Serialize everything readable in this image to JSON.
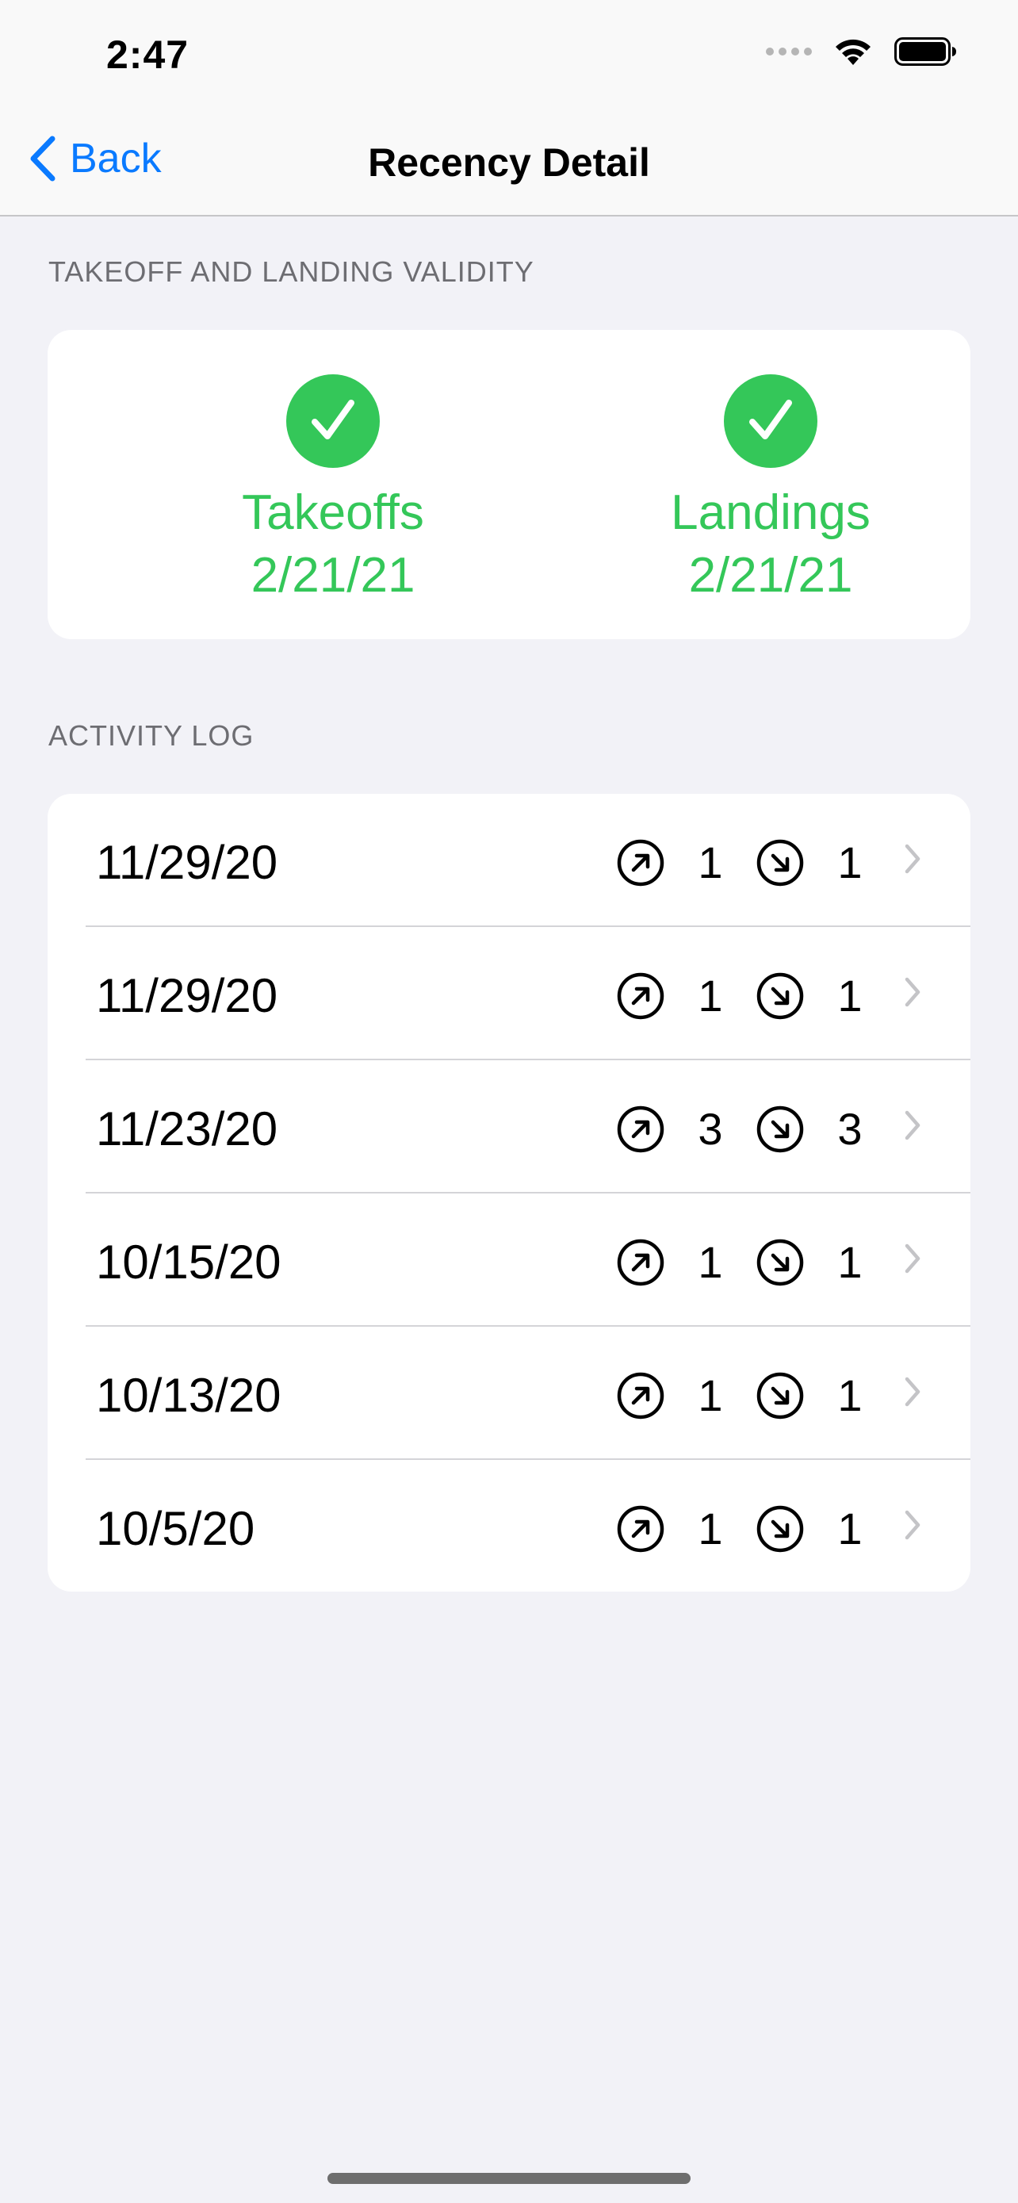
{
  "status_bar": {
    "time": "2:47"
  },
  "nav": {
    "back_label": "Back",
    "title": "Recency Detail"
  },
  "validity": {
    "header": "TAKEOFF AND LANDING VALIDITY",
    "takeoffs": {
      "label": "Takeoffs",
      "date": "2/21/21"
    },
    "landings": {
      "label": "Landings",
      "date": "2/21/21"
    }
  },
  "activity": {
    "header": "ACTIVITY LOG",
    "rows": [
      {
        "date": "11/29/20",
        "takeoffs": "1",
        "landings": "1"
      },
      {
        "date": "11/29/20",
        "takeoffs": "1",
        "landings": "1"
      },
      {
        "date": "11/23/20",
        "takeoffs": "3",
        "landings": "3"
      },
      {
        "date": "10/15/20",
        "takeoffs": "1",
        "landings": "1"
      },
      {
        "date": "10/13/20",
        "takeoffs": "1",
        "landings": "1"
      },
      {
        "date": "10/5/20",
        "takeoffs": "1",
        "landings": "1"
      }
    ]
  },
  "colors": {
    "accent": "#0a84ff",
    "valid": "#34c759",
    "background": "#f2f2f7"
  },
  "icons": {
    "takeoff": "arrow-up-right-circle-icon",
    "landing": "arrow-down-right-circle-icon",
    "valid": "checkmark-circle-icon",
    "back": "chevron-left-icon",
    "disclosure": "chevron-right-icon"
  }
}
